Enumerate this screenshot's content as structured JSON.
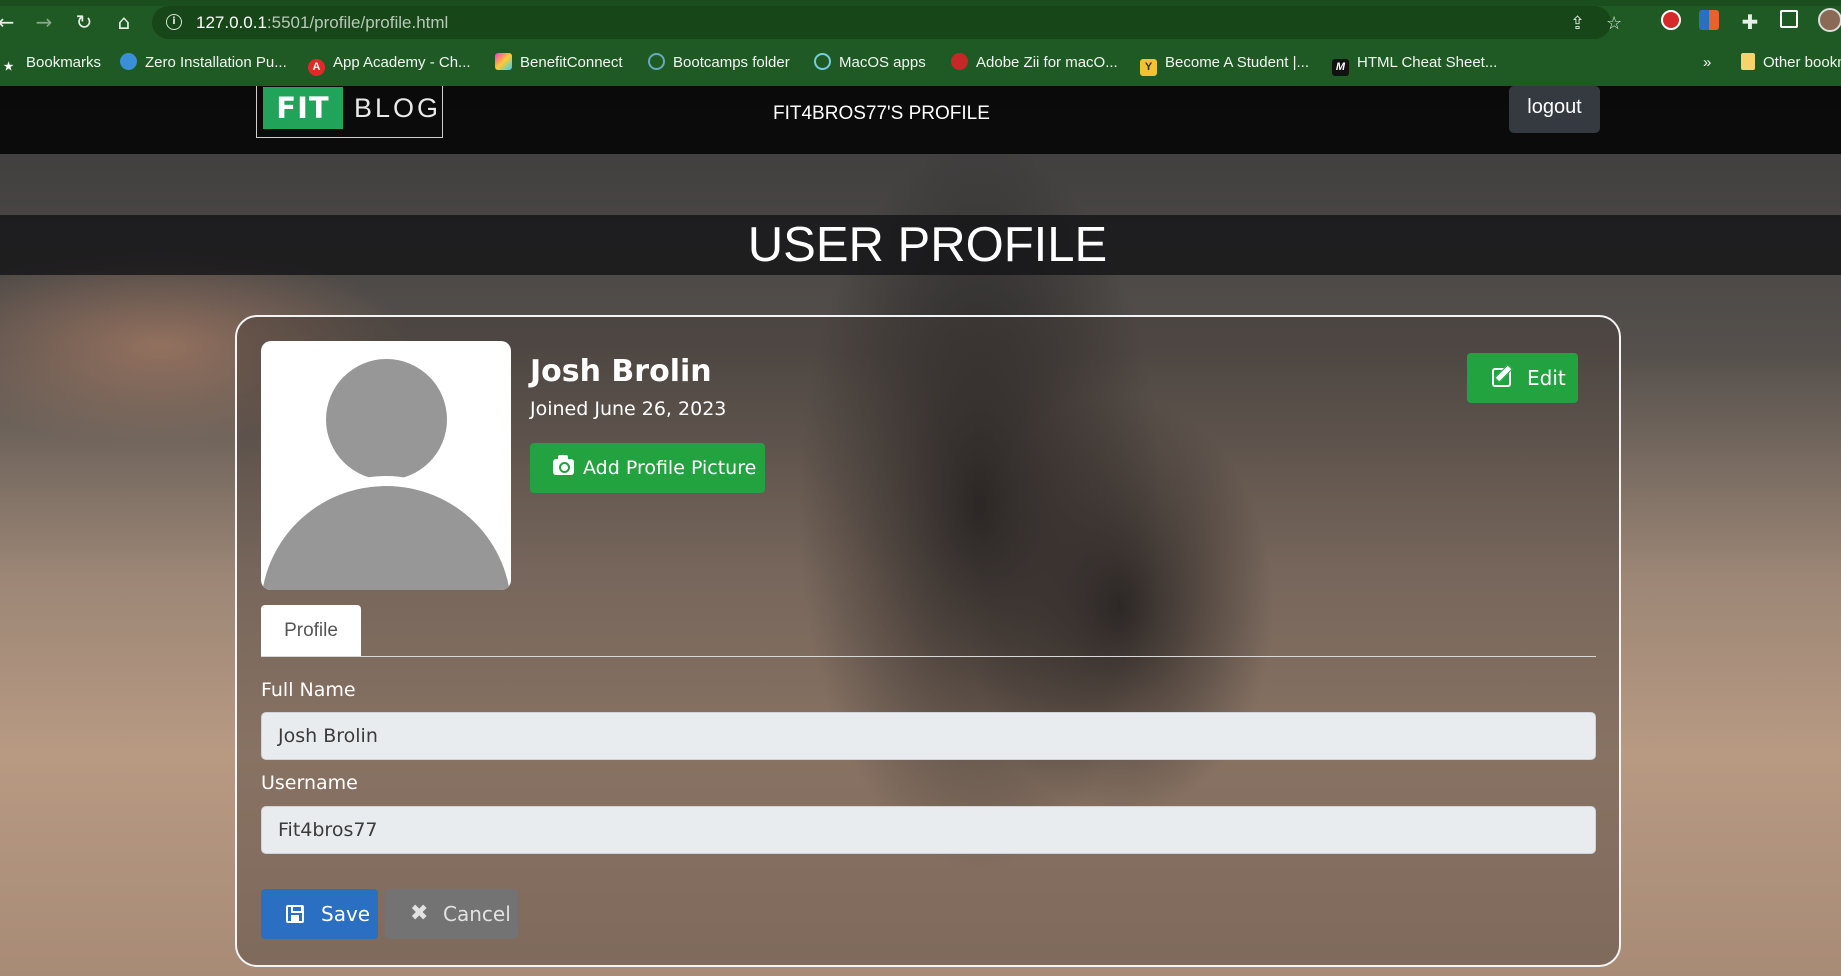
{
  "browser": {
    "url_host": "127.0.0.1",
    "url_rest": ":5501/profile/profile.html",
    "bookmarks": [
      {
        "label": "Bookmarks",
        "icon": "star-icon"
      },
      {
        "label": "Zero Installation Pu...",
        "icon": "cloud-icon"
      },
      {
        "label": "App Academy - Ch...",
        "icon": "app-academy-icon"
      },
      {
        "label": "BenefitConnect",
        "icon": "benefitconnect-icon"
      },
      {
        "label": "Bootcamps folder",
        "icon": "bootcamps-icon"
      },
      {
        "label": "MacOS apps",
        "icon": "macos-apps-icon"
      },
      {
        "label": "Adobe Zii for macO...",
        "icon": "adobe-icon"
      },
      {
        "label": "Become A Student |...",
        "icon": "student-icon"
      },
      {
        "label": "HTML Cheat Sheet...",
        "icon": "html-cheat-icon"
      }
    ],
    "more_bookmarks": "»",
    "other_bookmarks": "Other bookmarks"
  },
  "header": {
    "logo_fit": "FIT",
    "logo_blog": "BLOG",
    "page_heading": "FIT4BROS77'S PROFILE",
    "logout_label": "logout"
  },
  "banner": {
    "title": "USER PROFILE"
  },
  "profile": {
    "name": "Josh Brolin",
    "joined": "Joined June 26, 2023",
    "add_picture_label": "Add Profile Picture",
    "edit_label": "Edit",
    "tab_label": "Profile",
    "full_name_label": "Full Name",
    "full_name_value": "Josh Brolin",
    "username_label": "Username",
    "username_value": "Fit4bros77",
    "save_label": "Save",
    "cancel_label": "Cancel"
  },
  "colors": {
    "browser_chrome": "#1f5a24",
    "brand_green": "#22a35a",
    "button_green": "#22a340",
    "save_blue": "#2b6fc2",
    "cancel_gray": "#737373"
  }
}
